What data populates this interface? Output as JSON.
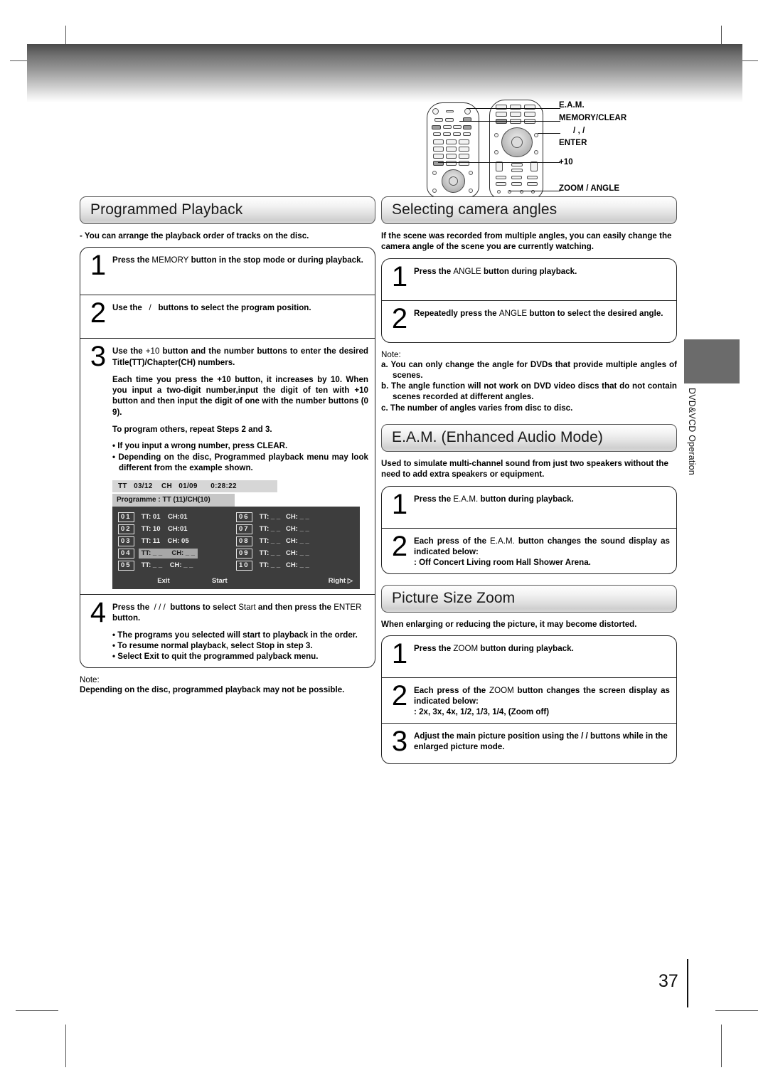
{
  "page": {
    "number": "37",
    "side_tab": "DVD&VCD Operation"
  },
  "remote": {
    "callouts": [
      {
        "label": "E.A.M."
      },
      {
        "label": "MEMORY/CLEAR"
      },
      {
        "label": "/    ,     /"
      },
      {
        "label": "ENTER"
      },
      {
        "label": "+10"
      },
      {
        "label": "ZOOM / ANGLE"
      }
    ]
  },
  "programmed_playback": {
    "title": "Programmed Playback",
    "lead": "-  You can arrange the playback order of tracks on the disc.",
    "steps": [
      {
        "num": "1",
        "text_parts": [
          "Press the ",
          "MEMORY",
          " button in the stop mode or during playback."
        ]
      },
      {
        "num": "2",
        "text_parts": [
          "Use the ",
          "/",
          " buttons to select the program position."
        ]
      },
      {
        "num": "3",
        "text_parts": [
          "Use the ",
          "+10",
          " button and the number buttons to enter the desired Title(TT)/Chapter(CH) numbers."
        ],
        "para1": "Each time you press the +10 button, it increases by 10. When you input a two-digit number,input the digit of ten with +10 button and then input the digit of one with the number buttons (0  9).",
        "para2": "To program others, repeat Steps 2 and 3.",
        "bullets": [
          "• If you input a wrong number, press CLEAR.",
          "• Depending on the disc, Programmed playback menu may look different from the example shown."
        ]
      },
      {
        "num": "4",
        "text_parts": [
          "Press the ",
          "/    /    /",
          " buttons to select Start and then press the ENTER button."
        ],
        "bullets": [
          "• The programs you selected will start to playback in the order.",
          "• To resume normal playback, select Stop in step 3.",
          "• Select Exit to quit the programmed palyback menu."
        ]
      }
    ],
    "osd": {
      "status": {
        "tt_label": "TT",
        "tt_value": "03/12",
        "ch_label": "CH",
        "ch_value": "01/09",
        "time": "0:28:22"
      },
      "programme_line": "Programme : TT (11)/CH(10)",
      "left_rows": [
        {
          "idx": "01",
          "text": "TT: 01    CH:01",
          "selected": false
        },
        {
          "idx": "02",
          "text": "TT: 10    CH:01",
          "selected": false
        },
        {
          "idx": "03",
          "text": "TT: 11    CH: 05",
          "selected": false
        },
        {
          "idx": "04",
          "text": "TT: _ _     CH: _ _",
          "selected": true
        },
        {
          "idx": "05",
          "text": "TT: _ _    CH: _ _",
          "selected": false
        }
      ],
      "right_rows": [
        {
          "idx": "06",
          "text": "TT: _ _   CH: _ _",
          "selected": false
        },
        {
          "idx": "07",
          "text": "TT: _ _   CH: _ _",
          "selected": false
        },
        {
          "idx": "08",
          "text": "TT: _ _   CH: _ _",
          "selected": false
        },
        {
          "idx": "09",
          "text": "TT: _ _   CH: _ _",
          "selected": false
        },
        {
          "idx": "10",
          "text": "TT: _ _   CH: _ _",
          "selected": false
        }
      ],
      "footer": {
        "exit": "Exit",
        "start": "Start",
        "right": "Right  ▷"
      }
    },
    "note": {
      "head": "Note:",
      "body": "Depending on the disc, programmed playback may not be possible."
    }
  },
  "camera_angles": {
    "title": "Selecting camera angles",
    "lead": "If the scene was recorded from multiple angles, you can easily change the camera angle of the scene you are currently watching.",
    "steps": [
      {
        "num": "1",
        "text": "Press the ANGLE button during playback."
      },
      {
        "num": "2",
        "text": "Repeatedly press the ANGLE button to select the desired angle."
      }
    ],
    "note": {
      "head": "Note:",
      "items": [
        "a. You can only change the angle for DVDs that provide multiple angles of scenes.",
        "b. The angle function will not work on DVD video discs that do not contain scenes recorded at different angles.",
        "c. The number of angles varies from disc to disc."
      ]
    }
  },
  "eam": {
    "title": "E.A.M. (Enhanced Audio Mode)",
    "lead": "Used to simulate multi-channel sound from just two speakers without the need to add extra speakers or equipment.",
    "steps": [
      {
        "num": "1",
        "text": "Press the E.A.M. button during playback."
      },
      {
        "num": "2",
        "text": "Each press of the E.A.M. button changes the sound display as indicated below:",
        "extra": ": Off    Concert    Living room    Hall    Shower    Arena."
      }
    ]
  },
  "picture_zoom": {
    "title": "Picture Size Zoom",
    "lead": "When enlarging or reducing the picture, it may become distorted.",
    "steps": [
      {
        "num": "1",
        "text": "Press the ZOOM button during playback."
      },
      {
        "num": "2",
        "text": "Each press of the ZOOM button changes the screen display as indicated below:",
        "extra": ": 2x, 3x, 4x, 1/2, 1/3, 1/4, (Zoom off)"
      },
      {
        "num": "3",
        "text": "Adjust the main picture position using the  /    /    buttons while in the enlarged picture mode."
      }
    ]
  }
}
